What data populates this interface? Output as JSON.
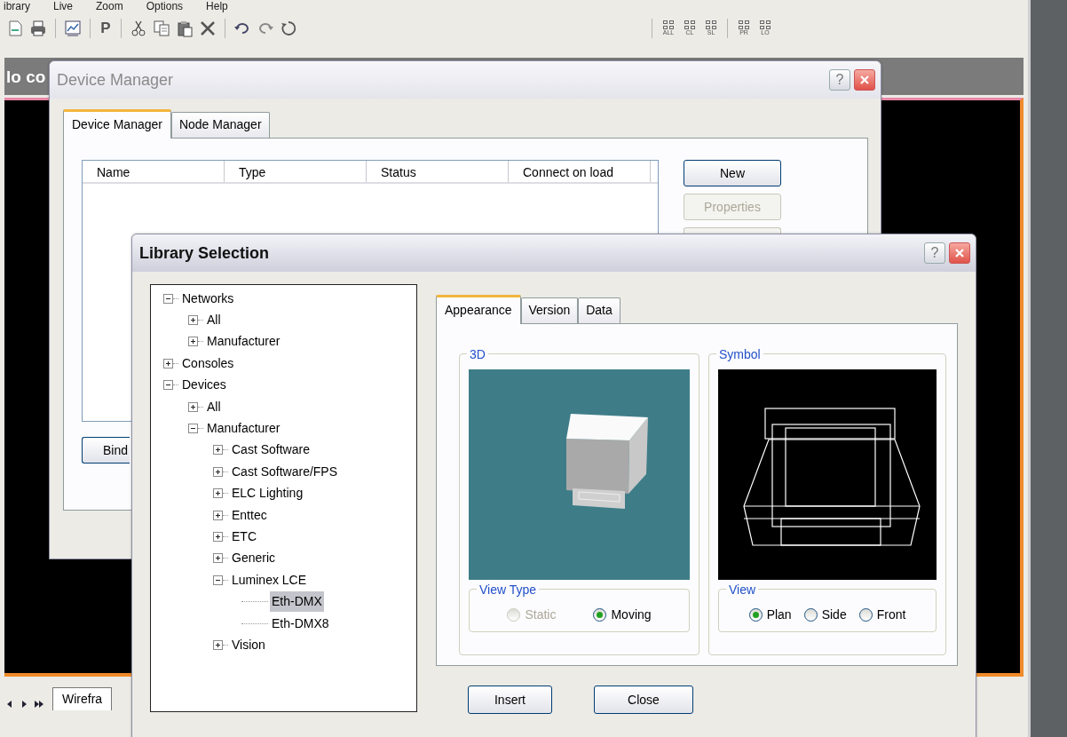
{
  "menu": [
    "ibrary",
    "Live",
    "Zoom",
    "Options",
    "Help"
  ],
  "toolbar": {
    "p_button": "P",
    "grid_buttons": [
      "ALL",
      "CL",
      "SL",
      "PR",
      "LO"
    ]
  },
  "document": {
    "title": "lo co",
    "tabs": [
      {
        "label": "Wirefra",
        "selected": true
      }
    ]
  },
  "device_manager": {
    "title": "Device Manager",
    "help_button": "?",
    "tabs": [
      {
        "label": "Device Manager",
        "selected": true
      },
      {
        "label": "Node  Manager",
        "selected": false
      }
    ],
    "columns": [
      "Name",
      "Type",
      "Status",
      "Connect on load"
    ],
    "buttons": [
      {
        "label": "New",
        "disabled": false
      },
      {
        "label": "Properties",
        "disabled": true
      }
    ],
    "bind_button": "Bind"
  },
  "library_selection": {
    "title": "Library Selection",
    "help_button": "?",
    "tree": [
      {
        "label": "Networks",
        "expanded": true,
        "selected": false,
        "children": [
          {
            "label": "All",
            "expanded": false,
            "selected": false
          },
          {
            "label": "Manufacturer",
            "expanded": false,
            "selected": false
          }
        ]
      },
      {
        "label": "Consoles",
        "expanded": false,
        "selected": false
      },
      {
        "label": "Devices",
        "expanded": true,
        "selected": false,
        "children": [
          {
            "label": "All",
            "expanded": false,
            "selected": false
          },
          {
            "label": "Manufacturer",
            "expanded": true,
            "selected": false,
            "children": [
              {
                "label": "Cast Software",
                "expanded": false,
                "selected": false
              },
              {
                "label": "Cast Software/FPS",
                "expanded": false,
                "selected": false
              },
              {
                "label": "ELC Lighting",
                "expanded": false,
                "selected": false
              },
              {
                "label": "Enttec",
                "expanded": false,
                "selected": false
              },
              {
                "label": "ETC",
                "expanded": false,
                "selected": false
              },
              {
                "label": "Generic",
                "expanded": false,
                "selected": false
              },
              {
                "label": "Luminex LCE",
                "expanded": true,
                "selected": false,
                "children": [
                  {
                    "label": "Eth-DMX",
                    "selected": true
                  },
                  {
                    "label": "Eth-DMX8",
                    "selected": false
                  }
                ]
              },
              {
                "label": "Vision",
                "expanded": false,
                "selected": false
              }
            ]
          }
        ]
      }
    ],
    "tabs": [
      {
        "label": "Appearance",
        "selected": true
      },
      {
        "label": "Version",
        "selected": false
      },
      {
        "label": "Data",
        "selected": false
      }
    ],
    "render_group": {
      "title": "3D",
      "options_title": "View Type",
      "options": [
        {
          "label": "Static",
          "selected": false,
          "disabled": true
        },
        {
          "label": "Moving",
          "selected": true,
          "disabled": false
        }
      ]
    },
    "symbol_group": {
      "title": "Symbol",
      "options_title": "View",
      "options": [
        {
          "label": "Plan",
          "selected": true,
          "disabled": false
        },
        {
          "label": "Side",
          "selected": false,
          "disabled": false
        },
        {
          "label": "Front",
          "selected": false,
          "disabled": false
        }
      ]
    },
    "buttons": [
      "Insert",
      "Close"
    ]
  }
}
